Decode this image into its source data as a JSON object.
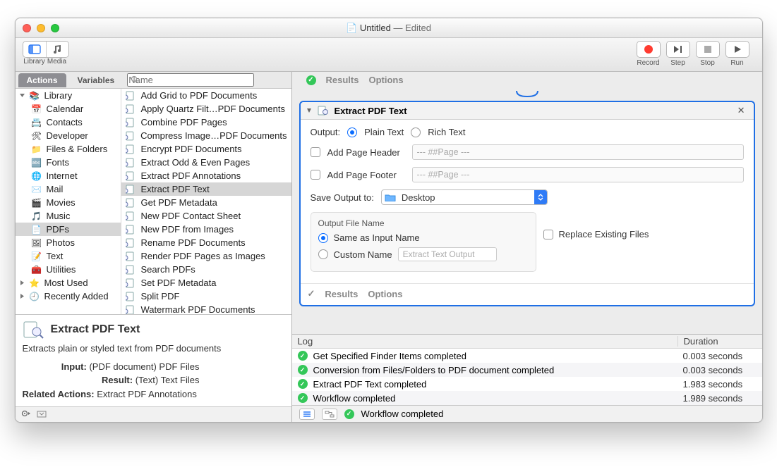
{
  "titlebar": {
    "doc_icon": "workflow-doc-icon",
    "name": "Untitled",
    "state": "— Edited"
  },
  "toolbar": {
    "library": "Library",
    "media": "Media",
    "record": "Record",
    "step": "Step",
    "stop": "Stop",
    "run": "Run"
  },
  "sidebar": {
    "tabs": {
      "actions": "Actions",
      "variables": "Variables"
    },
    "search_placeholder": "Name",
    "tree": [
      {
        "label": "Library",
        "expanded": true
      },
      {
        "label": "Calendar"
      },
      {
        "label": "Contacts"
      },
      {
        "label": "Developer"
      },
      {
        "label": "Files & Folders"
      },
      {
        "label": "Fonts"
      },
      {
        "label": "Internet"
      },
      {
        "label": "Mail"
      },
      {
        "label": "Movies"
      },
      {
        "label": "Music"
      },
      {
        "label": "PDFs",
        "selected": true
      },
      {
        "label": "Photos"
      },
      {
        "label": "Text"
      },
      {
        "label": "Utilities"
      },
      {
        "label": "Most Used",
        "top": true
      },
      {
        "label": "Recently Added",
        "top": true
      }
    ],
    "actions_list": [
      "Add Grid to PDF Documents",
      "Apply Quartz Filt…PDF Documents",
      "Combine PDF Pages",
      "Compress Image…PDF Documents",
      "Encrypt PDF Documents",
      "Extract Odd & Even Pages",
      "Extract PDF Annotations",
      "Extract PDF Text",
      "Get PDF Metadata",
      "New PDF Contact Sheet",
      "New PDF from Images",
      "Rename PDF Documents",
      "Render PDF Pages as Images",
      "Search PDFs",
      "Set PDF Metadata",
      "Split PDF",
      "Watermark PDF Documents"
    ],
    "actions_selected_index": 7,
    "detail": {
      "title": "Extract PDF Text",
      "desc": "Extracts plain or styled text from PDF documents",
      "input_k": "Input:",
      "input_v": "(PDF document) PDF Files",
      "result_k": "Result:",
      "result_v": "(Text) Text Files",
      "rel_k": "Related Actions:",
      "rel_v": "Extract PDF Annotations"
    }
  },
  "workflow": {
    "prev": {
      "results": "Results",
      "options": "Options"
    },
    "action": {
      "title": "Extract PDF Text",
      "output_label": "Output:",
      "plain": "Plain Text",
      "rich": "Rich Text",
      "add_header": "Add Page Header",
      "header_ph": "--- ##Page ---",
      "add_footer": "Add Page Footer",
      "footer_ph": "--- ##Page ---",
      "save_label": "Save Output to:",
      "save_dest": "Desktop",
      "ofn_label": "Output File Name",
      "same_name": "Same as Input Name",
      "custom_name": "Custom Name",
      "custom_ph": "Extract Text Output",
      "replace": "Replace Existing Files",
      "results": "Results",
      "options": "Options"
    }
  },
  "log": {
    "hdr_log": "Log",
    "hdr_dur": "Duration",
    "rows": [
      {
        "msg": "Get Specified Finder Items completed",
        "dur": "0.003 seconds"
      },
      {
        "msg": "Conversion from Files/Folders to PDF document completed",
        "dur": "0.003 seconds"
      },
      {
        "msg": "Extract PDF Text completed",
        "dur": "1.983 seconds"
      },
      {
        "msg": "Workflow completed",
        "dur": "1.989 seconds"
      }
    ],
    "footer_status": "Workflow completed"
  }
}
